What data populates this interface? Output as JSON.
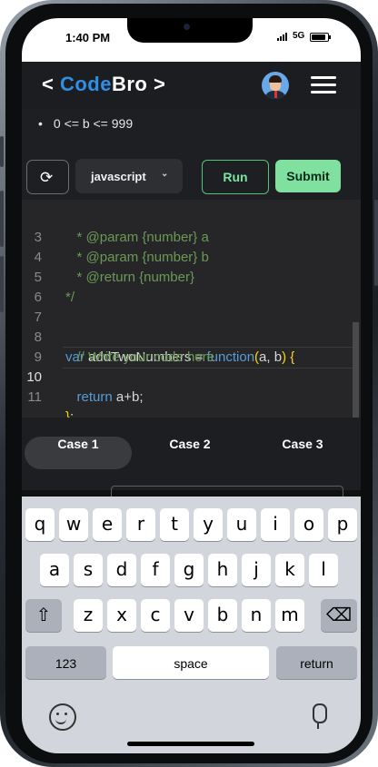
{
  "status": {
    "time": "1:40 PM",
    "network": "5G"
  },
  "header": {
    "logo_prefix": "<",
    "logo_code": "Code",
    "logo_bro": "Bro",
    "logo_suffix": ">"
  },
  "problem": {
    "constraint": "0 <= b <= 999"
  },
  "toolbar": {
    "language": "javascript",
    "run_label": "Run",
    "submit_label": "Submit"
  },
  "editor": {
    "lines": [
      {
        "num": "3",
        "text": "   * @param {number} a"
      },
      {
        "num": "4",
        "text": "   * @param {number} b"
      },
      {
        "num": "5",
        "text": "   * @return {number}"
      },
      {
        "num": "6",
        "text": "*/"
      },
      {
        "num": "7",
        "text": ""
      },
      {
        "num": "8",
        "text_parts": [
          "var",
          " addTwoNumbers = ",
          "function",
          "(",
          "a, b",
          ")",
          " {"
        ]
      },
      {
        "num": "9",
        "text": "   // Write your code here"
      },
      {
        "num": "10",
        "text_parts": [
          "   ",
          "return",
          " a+b;"
        ]
      },
      {
        "num": "11",
        "text_parts": [
          "}",
          ";"
        ]
      }
    ]
  },
  "cases": [
    "Case 1",
    "Case 2",
    "Case 3"
  ],
  "keyboard": {
    "row1": [
      "q",
      "w",
      "e",
      "r",
      "t",
      "y",
      "u",
      "i",
      "o",
      "p"
    ],
    "row2": [
      "a",
      "s",
      "d",
      "f",
      "g",
      "h",
      "j",
      "k",
      "l"
    ],
    "row3": [
      "z",
      "x",
      "c",
      "v",
      "b",
      "n",
      "m"
    ],
    "shift": "⇧",
    "backspace": "⌫",
    "numbers": "123",
    "space": "space",
    "return": "return"
  }
}
